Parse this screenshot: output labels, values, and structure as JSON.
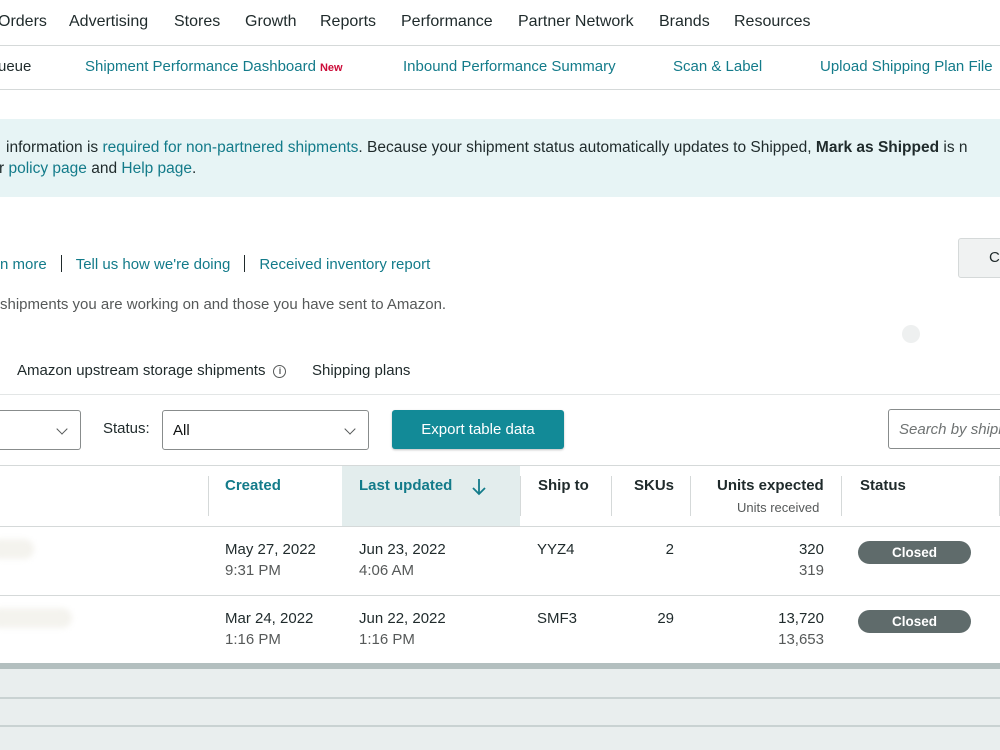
{
  "topnav": {
    "items": [
      "Orders",
      "Advertising",
      "Stores",
      "Growth",
      "Reports",
      "Performance",
      "Partner Network",
      "Brands",
      "Resources"
    ]
  },
  "subnav": {
    "items": [
      {
        "label": "ueue"
      },
      {
        "label": "Shipment Performance Dashboard",
        "badge": "New"
      },
      {
        "label": "Inbound Performance Summary"
      },
      {
        "label": "Scan & Label"
      },
      {
        "label": "Upload Shipping Plan File"
      }
    ]
  },
  "banner": {
    "line1_a": "information is ",
    "line1_link": "required for non-partnered shipments",
    "line1_b": ". Because your shipment status automatically updates to Shipped, ",
    "line1_bold": "Mark as Shipped",
    "line1_c": " is n",
    "line2_a": "r ",
    "line2_link1": "policy page",
    "line2_mid": " and ",
    "line2_link2": "Help page",
    "line2_end": "."
  },
  "links": {
    "learn_more": "n more",
    "feedback": "Tell us how we're doing",
    "report": "Received inventory report"
  },
  "description": "shipments you are working on and those you have sent to Amazon.",
  "right_button": "C",
  "tabs": {
    "upstream": "Amazon upstream storage shipments",
    "info": "i",
    "plans": "Shipping plans"
  },
  "filters": {
    "first_value": "",
    "status_label": "Status:",
    "status_value": "All",
    "export_label": "Export table data",
    "search_placeholder": "Search by shipment"
  },
  "table": {
    "headers": {
      "created": "Created",
      "last_updated": "Last updated",
      "ship_to": "Ship to",
      "skus": "SKUs",
      "units_expected": "Units expected",
      "units_received": "Units received",
      "status": "Status"
    },
    "rows": [
      {
        "created_date": "May 27, 2022",
        "created_time": "9:31 PM",
        "updated_date": "Jun 23, 2022",
        "updated_time": "4:06 AM",
        "ship_to": "YYZ4",
        "skus": "2",
        "units_expected": "320",
        "units_received": "319",
        "status": "Closed"
      },
      {
        "created_date": "Mar 24, 2022",
        "created_time": "1:16 PM",
        "updated_date": "Jun 22, 2022",
        "updated_time": "1:16 PM",
        "ship_to": "SMF3",
        "skus": "29",
        "units_expected": "13,720",
        "units_received": "13,653",
        "status": "Closed"
      }
    ]
  },
  "colors": {
    "accent": "#137b8a",
    "button": "#128a97",
    "banner": "#e7f4f5",
    "pill": "#5f6b6b",
    "new_badge": "#cc0c39"
  }
}
